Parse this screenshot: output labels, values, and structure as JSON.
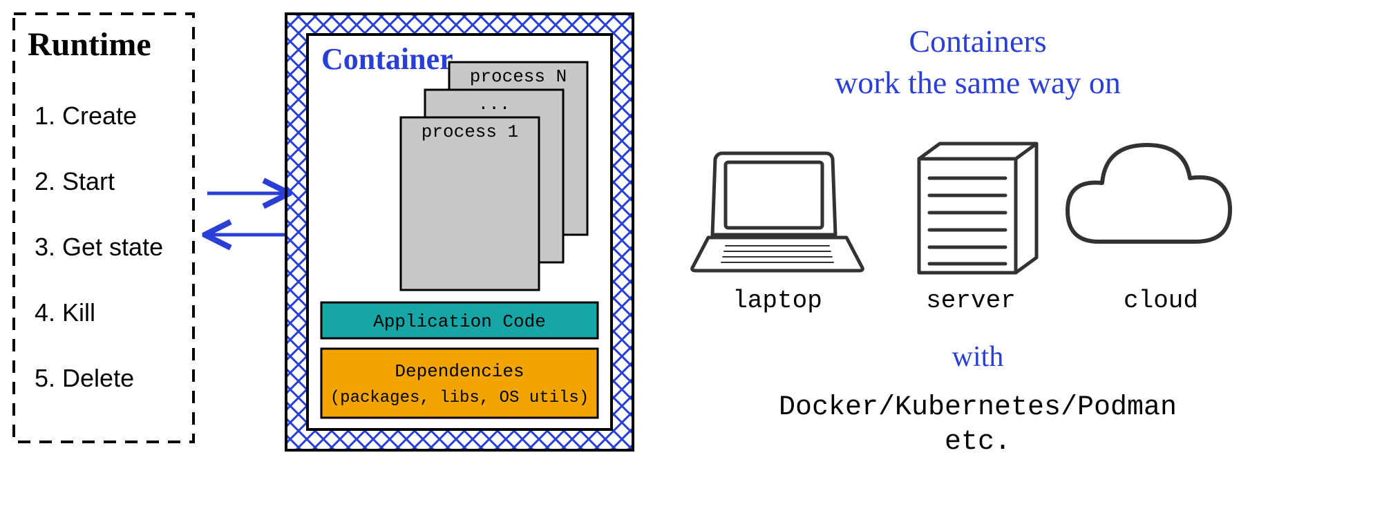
{
  "runtime": {
    "title": "Runtime",
    "ops": [
      "1. Create",
      "2. Start",
      "3. Get state",
      "4. Kill",
      "5. Delete"
    ]
  },
  "container": {
    "title": "Container",
    "processes": {
      "back_label": "process N",
      "mid_label": "...",
      "front_label": "process 1"
    },
    "app_code": "Application Code",
    "deps_title": "Dependencies",
    "deps_sub": "(packages, libs, OS utils)"
  },
  "right": {
    "headline1": "Containers",
    "headline2": "work the same way on",
    "platforms": {
      "laptop": "laptop",
      "server": "server",
      "cloud": "cloud"
    },
    "with": "with",
    "tools1": "Docker/Kubernetes/Podman",
    "tools2": "etc."
  },
  "colors": {
    "blue": "#2a3fd6",
    "teal": "#17a6a6",
    "orange": "#f2a500",
    "gray": "#c8c8c8",
    "ink": "#323232"
  }
}
